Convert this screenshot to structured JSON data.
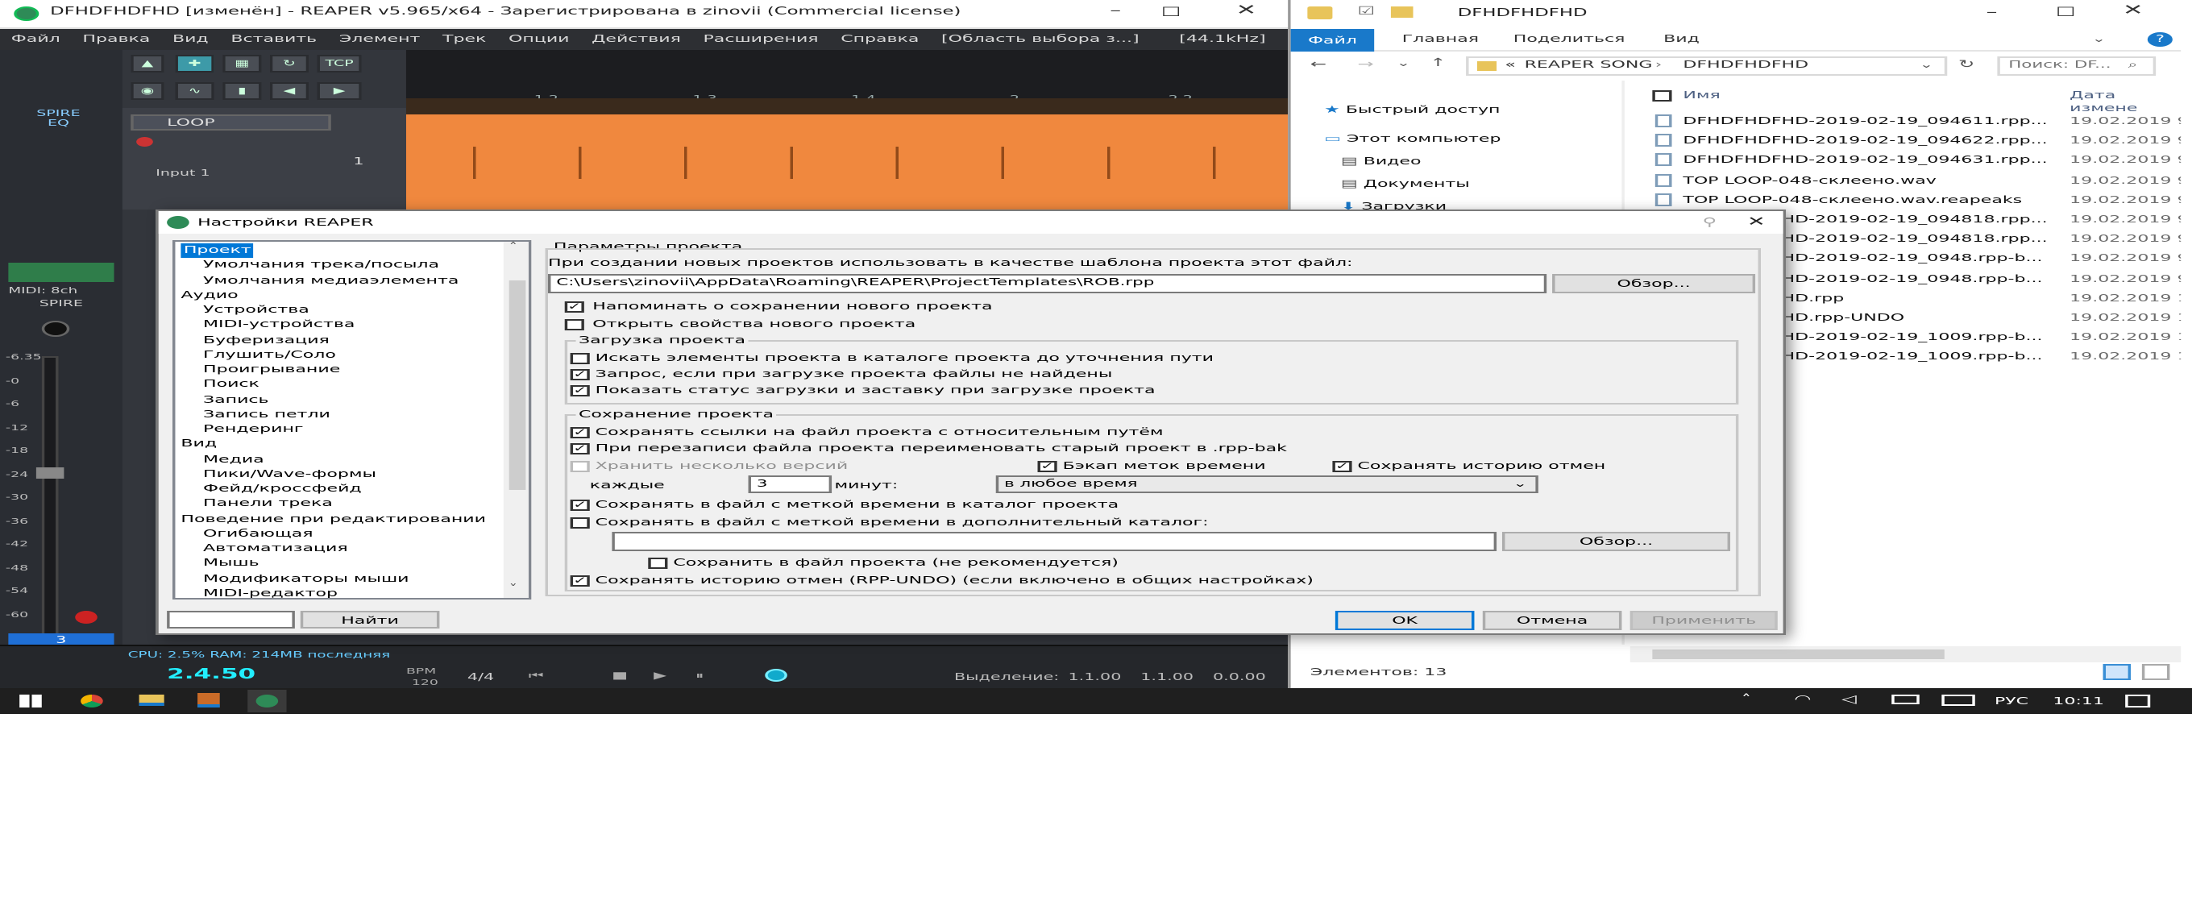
{
  "reaper": {
    "title": "DFHDFHDFHD [изменён] - REAPER v5.965/x64 - Зарегистрирована в zinovii (Commercial license)",
    "menu": [
      "Файл",
      "Правка",
      "Вид",
      "Вставить",
      "Элемент",
      "Трек",
      "Опции",
      "Действия",
      "Расширения",
      "Справка",
      "[Область выбора з...]",
      "[44.1kHz]"
    ],
    "tcp_label": "TCP",
    "track_name": "LOOP",
    "track_input": "Input 1",
    "track_num": "1",
    "ruler": [
      "1.2",
      "1.3",
      "1.4",
      "2",
      "2.2"
    ],
    "fx_label_1": "SPIRE",
    "fx_label_2": "EQ",
    "fx_label_3": "SPIRE",
    "midi_label": "MIDI: 8ch",
    "mixer_scale": [
      "-6.35",
      "-0",
      "-6",
      "-12",
      "-18",
      "-24",
      "-30",
      "-36",
      "-42",
      "-48",
      "-54",
      "-60"
    ],
    "mixer_track_num": "3",
    "status_text": "CPU: 2.5% RAM: 214MB последняя",
    "bpm_value": "2.4.50",
    "bpm_label": "BPM",
    "bpm_sub": "120",
    "time_sig": "4/4",
    "selection_label": "Выделение:",
    "selection_start": "1.1.00",
    "selection_end": "1.1.00",
    "selection_len": "0.0.00"
  },
  "dialog": {
    "title": "Настройки REAPER",
    "tree": [
      {
        "label": "Проект",
        "indent": 0,
        "selected": true
      },
      {
        "label": "Умолчания трека/посыла",
        "indent": 1
      },
      {
        "label": "Умолчания медиаэлемента",
        "indent": 1
      },
      {
        "label": "Аудио",
        "indent": 0
      },
      {
        "label": "Устройства",
        "indent": 1
      },
      {
        "label": "MIDI-устройства",
        "indent": 1
      },
      {
        "label": "Буферизация",
        "indent": 1
      },
      {
        "label": "Глушить/Соло",
        "indent": 1
      },
      {
        "label": "Проигрывание",
        "indent": 1
      },
      {
        "label": "Поиск",
        "indent": 1
      },
      {
        "label": "Запись",
        "indent": 1
      },
      {
        "label": "Запись петли",
        "indent": 1
      },
      {
        "label": "Рендеринг",
        "indent": 1
      },
      {
        "label": "Вид",
        "indent": 0
      },
      {
        "label": "Медиа",
        "indent": 1
      },
      {
        "label": "Пики/Wave-формы",
        "indent": 1
      },
      {
        "label": "Фейд/кроссфейд",
        "indent": 1
      },
      {
        "label": "Панели трека",
        "indent": 1
      },
      {
        "label": "Поведение при редактировании",
        "indent": 0
      },
      {
        "label": "Огибающая",
        "indent": 1
      },
      {
        "label": "Автоматизация",
        "indent": 1
      },
      {
        "label": "Мышь",
        "indent": 1
      },
      {
        "label": "Модификаторы мыши",
        "indent": 1
      },
      {
        "label": "MIDI-редактор",
        "indent": 1
      }
    ],
    "find_button": "Найти",
    "find_value": "",
    "section_title": "Параметры проекта",
    "template_label": "При создании новых проектов использовать в качестве шаблона проекта этот файл:",
    "template_path": "C:\\Users\\zinovii\\AppData\\Roaming\\REAPER\\ProjectTemplates\\ROB.rpp",
    "browse_button": "Обзор...",
    "remind_save": {
      "label": "Напоминать о сохранении нового проекта",
      "checked": true
    },
    "open_props": {
      "label": "Открыть свойства нового проекта",
      "checked": false
    },
    "load_group": "Загрузка проекта",
    "load_search": {
      "label": "Искать элементы проекта в каталоге проекта до уточнения пути",
      "checked": false
    },
    "load_prompt": {
      "label": "Запрос, если при загрузке проекта файлы не найдены",
      "checked": true
    },
    "load_status": {
      "label": "Показать статус загрузки и заставку при загрузке проекта",
      "checked": true
    },
    "save_group": "Сохранение проекта",
    "save_relative": {
      "label": "Сохранять ссылки на файл проекта с относительным путём",
      "checked": true
    },
    "save_rename_bak": {
      "label": "При перезаписи файла проекта переименовать старый проект в .rpp-bak",
      "checked": true
    },
    "keep_versions": {
      "label": "Хранить несколько версий",
      "checked": false
    },
    "backup_timestamp": {
      "label": "Бэкап меток времени",
      "checked": true
    },
    "save_undo_hist": {
      "label": "Сохранять историю отмен",
      "checked": true
    },
    "every_label": "каждые",
    "every_value": "3",
    "minutes_label": "минут:",
    "when_select": "в любое время",
    "save_ts_project": {
      "label": "Сохранять в файл с меткой времени в каталог проекта",
      "checked": true
    },
    "save_ts_extra": {
      "label": "Сохранять в файл с меткой времени в дополнительный каталог:",
      "checked": false
    },
    "extra_path": "",
    "browse_button_2": "Обзор...",
    "save_in_project": {
      "label": "Сохранить в файл проекта (не рекомендуется)",
      "checked": false
    },
    "save_rpp_undo": {
      "label": "Сохранять историю отмен (RPP-UNDO) (если включено в общих настройках)",
      "checked": true
    },
    "ok": "OK",
    "cancel": "Отмена",
    "apply": "Применить"
  },
  "explorer": {
    "title": "DFHDFHDFHD",
    "ribbon_tabs": [
      "Файл",
      "Главная",
      "Поделиться",
      "Вид"
    ],
    "breadcrumb_prefix": "«",
    "breadcrumb": [
      "REAPER SONG",
      "DFHDFHDFHD"
    ],
    "search_placeholder": "Поиск: DF...",
    "nav": [
      {
        "label": "Быстрый доступ",
        "icon": "star-icon"
      },
      {
        "label": "Этот компьютер",
        "icon": "computer-icon"
      },
      {
        "label": "Видео",
        "icon": "video-folder-icon"
      },
      {
        "label": "Документы",
        "icon": "documents-folder-icon"
      },
      {
        "label": "Загрузки",
        "icon": "downloads-folder-icon"
      }
    ],
    "col_name": "Имя",
    "col_date": "Дата измене",
    "files": [
      {
        "name": "DFHDFHDFHD-2019-02-19_094611.rpp...",
        "date": "19.02.2019 9:"
      },
      {
        "name": "DFHDFHDFHD-2019-02-19_094622.rpp...",
        "date": "19.02.2019 9:"
      },
      {
        "name": "DFHDFHDFHD-2019-02-19_094631.rpp...",
        "date": "19.02.2019 9:"
      },
      {
        "name": "TOP LOOP-048-склеено.wav",
        "date": "19.02.2019 9:"
      },
      {
        "name": "TOP LOOP-048-склеено.wav.reapeaks",
        "date": "19.02.2019 9:"
      },
      {
        "name": "DFHDFHDFHD-2019-02-19_094818.rpp...",
        "date": "19.02.2019 9:"
      },
      {
        "name": "DFHDFHDFHD-2019-02-19_094818.rpp...",
        "date": "19.02.2019 9:"
      },
      {
        "name": "DFHDFHDFHD-2019-02-19_0948.rpp-b...",
        "date": "19.02.2019 9:"
      },
      {
        "name": "DFHDFHDFHD-2019-02-19_0948.rpp-b...",
        "date": "19.02.2019 9:"
      },
      {
        "name": "DFHDFHDFHD.rpp",
        "date": "19.02.2019 10"
      },
      {
        "name": "DFHDFHDFHD.rpp-UNDO",
        "date": "19.02.2019 10"
      },
      {
        "name": "DFHDFHDFHD-2019-02-19_1009.rpp-b...",
        "date": "19.02.2019 10"
      },
      {
        "name": "DFHDFHDFHD-2019-02-19_1009.rpp-b...",
        "date": "19.02.2019 10"
      }
    ],
    "status": "Элементов: 13"
  },
  "taskbar": {
    "lang": "РУС",
    "time": "10:11"
  },
  "colors": {
    "reaper_bg": "#33363c",
    "waveform": "#f0883e",
    "accent": "#0078d7",
    "taskbar": "#1f1f1f"
  }
}
